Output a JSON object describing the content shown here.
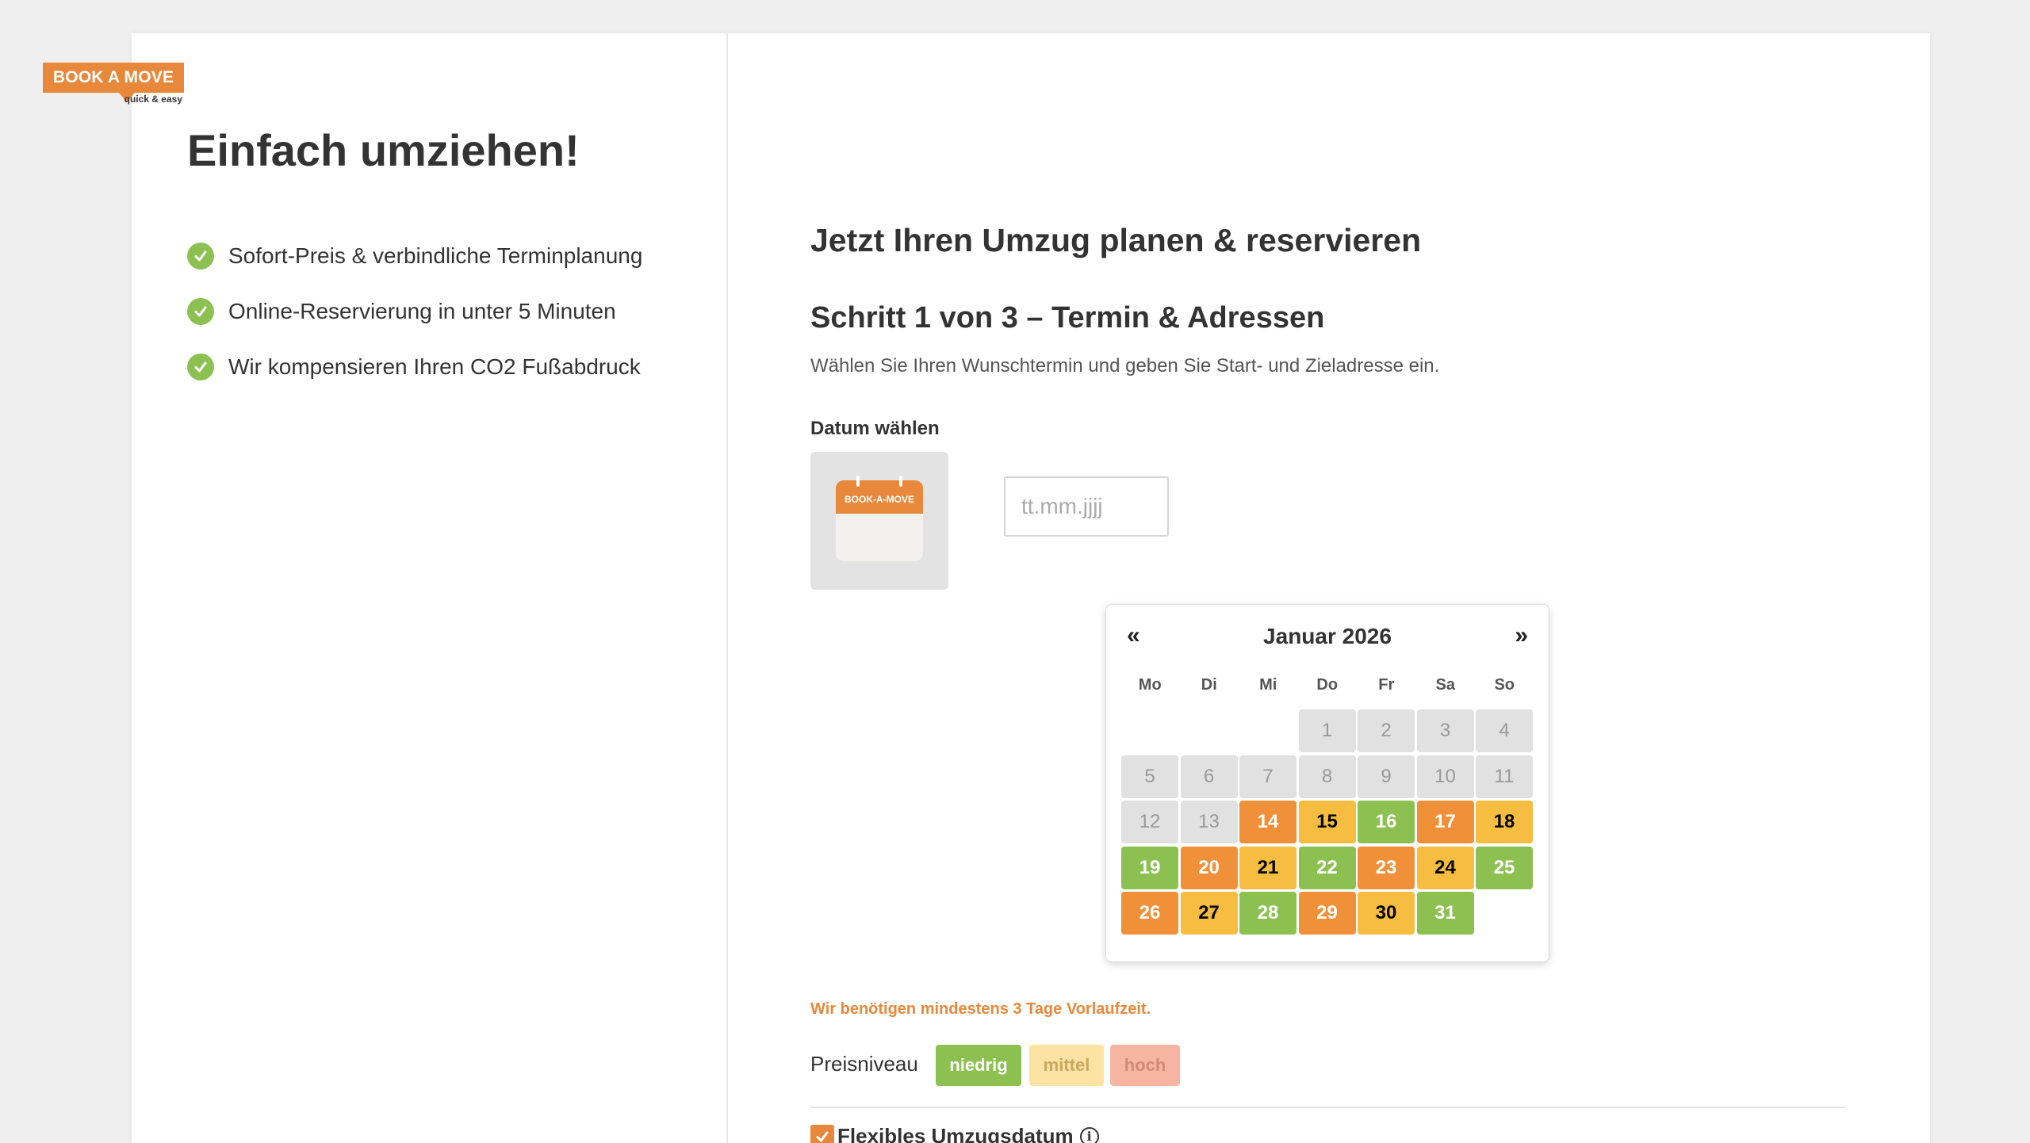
{
  "logo": {
    "brand": "BOOK A MOVE",
    "tagline": "quick & easy"
  },
  "left": {
    "title": "Einfach umziehen!",
    "features": [
      "Sofort-Preis & verbindliche Terminplanung",
      "Online-Reservierung in unter 5 Minuten",
      "Wir kompensieren Ihren CO2 Fußabdruck"
    ]
  },
  "main": {
    "title": "Jetzt Ihren Umzug planen & reservieren",
    "step_title": "Schritt 1 von 3 – Termin & Adressen",
    "step_description": "Wählen Sie Ihren Wunschtermin und geben Sie Start- und Zieladresse ein.",
    "date_label": "Datum wählen",
    "calendar_icon_text": "BOOK-A-MOVE",
    "date_input": {
      "value": "",
      "placeholder": "tt.mm.jjjj"
    }
  },
  "datepicker": {
    "prev": "«",
    "next": "»",
    "month_label": "Januar 2026",
    "weekdays": [
      "Mo",
      "Di",
      "Mi",
      "Do",
      "Fr",
      "Sa",
      "So"
    ],
    "days": [
      {
        "d": "",
        "s": "empty"
      },
      {
        "d": "",
        "s": "empty"
      },
      {
        "d": "",
        "s": "empty"
      },
      {
        "d": "1",
        "s": "disabled"
      },
      {
        "d": "2",
        "s": "disabled"
      },
      {
        "d": "3",
        "s": "disabled"
      },
      {
        "d": "4",
        "s": "disabled"
      },
      {
        "d": "5",
        "s": "disabled"
      },
      {
        "d": "6",
        "s": "disabled"
      },
      {
        "d": "7",
        "s": "disabled"
      },
      {
        "d": "8",
        "s": "disabled"
      },
      {
        "d": "9",
        "s": "disabled"
      },
      {
        "d": "10",
        "s": "disabled"
      },
      {
        "d": "11",
        "s": "disabled"
      },
      {
        "d": "12",
        "s": "disabled"
      },
      {
        "d": "13",
        "s": "disabled"
      },
      {
        "d": "14",
        "s": "high"
      },
      {
        "d": "15",
        "s": "mid"
      },
      {
        "d": "16",
        "s": "low"
      },
      {
        "d": "17",
        "s": "high"
      },
      {
        "d": "18",
        "s": "mid"
      },
      {
        "d": "19",
        "s": "low"
      },
      {
        "d": "20",
        "s": "high"
      },
      {
        "d": "21",
        "s": "mid"
      },
      {
        "d": "22",
        "s": "low"
      },
      {
        "d": "23",
        "s": "high"
      },
      {
        "d": "24",
        "s": "mid"
      },
      {
        "d": "25",
        "s": "low"
      },
      {
        "d": "26",
        "s": "high"
      },
      {
        "d": "27",
        "s": "mid"
      },
      {
        "d": "28",
        "s": "low"
      },
      {
        "d": "29",
        "s": "high"
      },
      {
        "d": "30",
        "s": "mid"
      },
      {
        "d": "31",
        "s": "low"
      }
    ]
  },
  "lead_time_note": "Wir benötigen mindestens 3 Tage Vorlaufzeit.",
  "price_level": {
    "label": "Preisniveau",
    "low": "niedrig",
    "mid": "mittel",
    "high": "hoch"
  },
  "flexible_date": {
    "label": "Flexibles Umzugsdatum",
    "checked": true,
    "info_glyph": "i"
  },
  "colors": {
    "accent": "#e8883a",
    "low": "#8cc152",
    "mid": "#f6bd41",
    "high": "#f0913a",
    "disabled": "#e1e1e1"
  }
}
